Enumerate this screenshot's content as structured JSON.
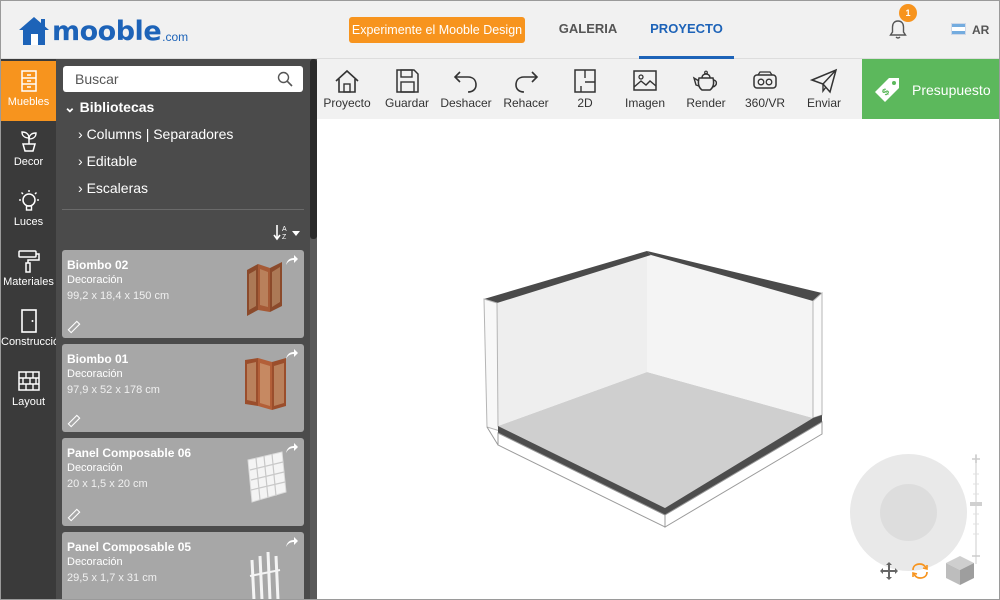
{
  "header": {
    "logo_text": "mooble",
    "logo_suffix": ".com",
    "promo_button": "Experimente el Mooble Design",
    "nav": [
      {
        "label": "GALERIA",
        "active": false
      },
      {
        "label": "PROYECTO",
        "active": true
      }
    ],
    "notification_count": "1",
    "language": "AR"
  },
  "rail": [
    {
      "label": "Muebles",
      "icon": "cabinet-icon",
      "active": true
    },
    {
      "label": "Decor",
      "icon": "plant-icon",
      "active": false
    },
    {
      "label": "Luces",
      "icon": "lightbulb-icon",
      "active": false
    },
    {
      "label": "Materiales",
      "icon": "paint-roller-icon",
      "active": false
    },
    {
      "label": "Construcción",
      "icon": "door-icon",
      "active": false
    },
    {
      "label": "Layout",
      "icon": "brick-wall-icon",
      "active": false
    }
  ],
  "panel": {
    "search_placeholder": "Buscar",
    "library_title": "Bibliotecas",
    "library_items": [
      "Columns | Separadores",
      "Editable",
      "Escaleras"
    ],
    "products": [
      {
        "name": "Biombo 02",
        "category": "Decoración",
        "dimensions": "99,2 x 18,4 x 150 cm"
      },
      {
        "name": "Biombo 01",
        "category": "Decoración",
        "dimensions": "97,9 x 52 x 178 cm"
      },
      {
        "name": "Panel Composable 06",
        "category": "Decoración",
        "dimensions": "20 x 1,5 x 20 cm"
      },
      {
        "name": "Panel Composable 05",
        "category": "Decoración",
        "dimensions": "29,5 x 1,7 x 31 cm"
      }
    ]
  },
  "toolbar": {
    "tools": [
      "Proyecto",
      "Guardar",
      "Deshacer",
      "Rehacer",
      "2D",
      "Imagen",
      "Render",
      "360/VR",
      "Enviar"
    ],
    "budget_button": "Presupuesto"
  },
  "colors": {
    "brand_blue": "#1d63b8",
    "accent_orange": "#f7941e",
    "budget_green": "#5cb85c"
  }
}
